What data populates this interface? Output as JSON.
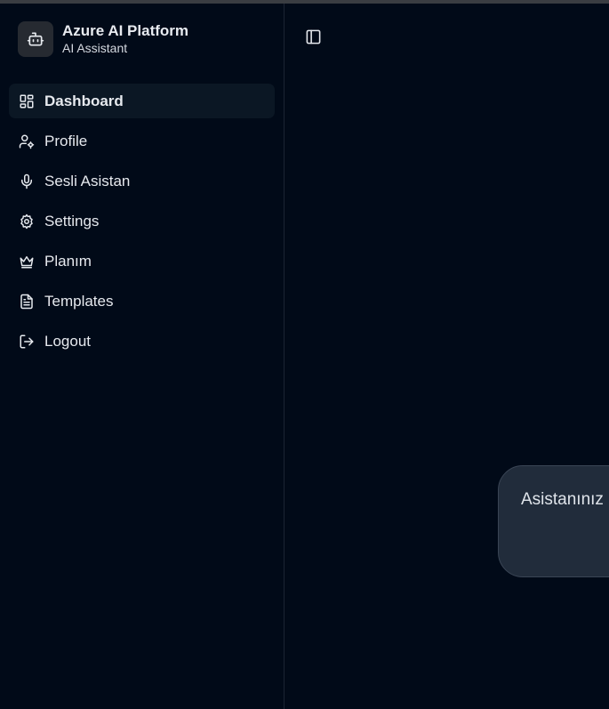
{
  "brand": {
    "title": "Azure AI Platform",
    "subtitle": "AI Assistant",
    "logo_icon": "bot-icon"
  },
  "sidebar": {
    "items": [
      {
        "label": "Dashboard",
        "icon": "layout-dashboard-icon",
        "active": true
      },
      {
        "label": "Profile",
        "icon": "user-cog-icon",
        "active": false
      },
      {
        "label": "Sesli Asistan",
        "icon": "microphone-icon",
        "active": false
      },
      {
        "label": "Settings",
        "icon": "gear-icon",
        "active": false
      },
      {
        "label": "Planım",
        "icon": "crown-icon",
        "active": false
      },
      {
        "label": "Templates",
        "icon": "file-text-icon",
        "active": false
      },
      {
        "label": "Logout",
        "icon": "logout-icon",
        "active": false
      }
    ]
  },
  "main": {
    "toggle_icon": "panel-left-icon",
    "message": "Asistanınız"
  },
  "colors": {
    "background": "#010a18",
    "active_item": "#0b1724",
    "bubble": "#212c3b"
  }
}
